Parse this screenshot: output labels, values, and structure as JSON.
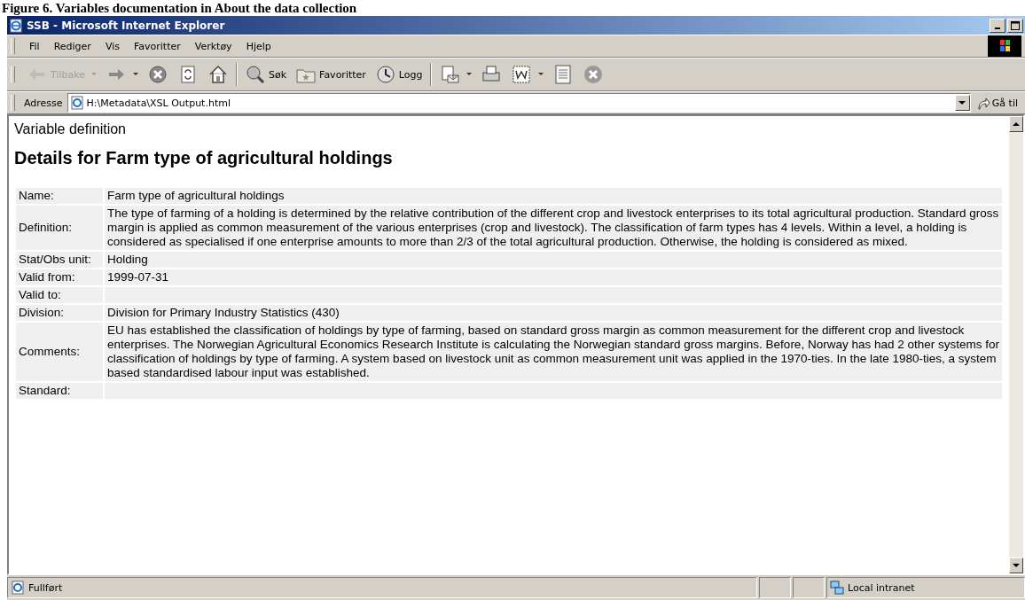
{
  "caption": "Figure 6. Variables documentation in About the data collection",
  "window": {
    "title": "SSB - Microsoft Internet Explorer"
  },
  "menu": [
    "Fil",
    "Rediger",
    "Vis",
    "Favoritter",
    "Verktøy",
    "Hjelp"
  ],
  "toolbar": [
    {
      "kind": "back",
      "label": "Tilbake",
      "disabled": true,
      "dropdown": true
    },
    {
      "kind": "forward",
      "disabled": false,
      "dropdown": true
    },
    {
      "kind": "stop",
      "disabled": false,
      "dropdown": false
    },
    {
      "kind": "refresh",
      "disabled": false,
      "dropdown": false
    },
    {
      "kind": "home",
      "disabled": false,
      "dropdown": false
    },
    {
      "kind": "search",
      "label": "Søk",
      "disabled": false,
      "dropdown": false
    },
    {
      "kind": "favorites",
      "label": "Favoritter",
      "disabled": false,
      "dropdown": false
    },
    {
      "kind": "history",
      "label": "Logg",
      "disabled": false,
      "dropdown": false
    },
    {
      "kind": "mail",
      "disabled": false,
      "dropdown": true
    },
    {
      "kind": "print",
      "disabled": false,
      "dropdown": false
    },
    {
      "kind": "edit",
      "disabled": false,
      "dropdown": true
    },
    {
      "kind": "discuss",
      "disabled": false,
      "dropdown": false
    },
    {
      "kind": "messenger",
      "disabled": false,
      "dropdown": false
    }
  ],
  "address": {
    "label": "Adresse",
    "value": "H:\\Metadata\\XSL Output.html",
    "go": "Gå til"
  },
  "page": {
    "kicker": "Variable definition",
    "heading": "Details for Farm type of agricultural holdings",
    "fields": [
      {
        "label": "Name:",
        "value": "Farm type of agricultural holdings"
      },
      {
        "label": "Definition:",
        "value": "The type of farming of a holding is determined by the relative contribution of the different crop and livestock enterprises to its total agricultural production. Standard gross margin is applied as common measurement of the various enterprises (crop and livestock). The classification of farm types has 4 levels. Within a level, a holding is considered as specialised if one enterprise amounts to more than 2/3 of the total agricultural production. Otherwise, the holding is considered as mixed."
      },
      {
        "label": "Stat/Obs unit:",
        "value": "Holding"
      },
      {
        "label": "Valid from:",
        "value": "1999-07-31"
      },
      {
        "label": "Valid to:"
      },
      {
        "label": "Division:",
        "value": "Division for Primary Industry Statistics (430)"
      },
      {
        "label": "Comments:",
        "value": "EU has established the classification of holdings by type of farming, based on standard gross margin as common measurement for the different crop and livestock enterprises. The Norwegian Agricultural Economics Research Institute is calculating the Norwegian standard gross margins. Before, Norway has had 2 other systems for classification of holdings by type of farming. A system based on livestock unit as common measurement unit was applied in the 1970-ties. In the late 1980-ties, a system based standardised labour input was established."
      },
      {
        "label": "Standard:"
      }
    ]
  },
  "status": {
    "text": "Fullført",
    "zone": "Local intranet"
  }
}
